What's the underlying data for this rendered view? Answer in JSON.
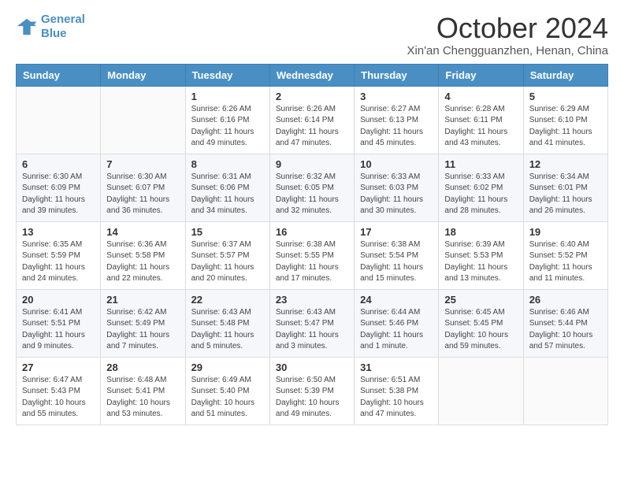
{
  "logo": {
    "line1": "General",
    "line2": "Blue"
  },
  "title": "October 2024",
  "subtitle": "Xin'an Chengguanzhen, Henan, China",
  "weekdays": [
    "Sunday",
    "Monday",
    "Tuesday",
    "Wednesday",
    "Thursday",
    "Friday",
    "Saturday"
  ],
  "weeks": [
    [
      {
        "day": "",
        "info": ""
      },
      {
        "day": "",
        "info": ""
      },
      {
        "day": "1",
        "info": "Sunrise: 6:26 AM\nSunset: 6:16 PM\nDaylight: 11 hours and 49 minutes."
      },
      {
        "day": "2",
        "info": "Sunrise: 6:26 AM\nSunset: 6:14 PM\nDaylight: 11 hours and 47 minutes."
      },
      {
        "day": "3",
        "info": "Sunrise: 6:27 AM\nSunset: 6:13 PM\nDaylight: 11 hours and 45 minutes."
      },
      {
        "day": "4",
        "info": "Sunrise: 6:28 AM\nSunset: 6:11 PM\nDaylight: 11 hours and 43 minutes."
      },
      {
        "day": "5",
        "info": "Sunrise: 6:29 AM\nSunset: 6:10 PM\nDaylight: 11 hours and 41 minutes."
      }
    ],
    [
      {
        "day": "6",
        "info": "Sunrise: 6:30 AM\nSunset: 6:09 PM\nDaylight: 11 hours and 39 minutes."
      },
      {
        "day": "7",
        "info": "Sunrise: 6:30 AM\nSunset: 6:07 PM\nDaylight: 11 hours and 36 minutes."
      },
      {
        "day": "8",
        "info": "Sunrise: 6:31 AM\nSunset: 6:06 PM\nDaylight: 11 hours and 34 minutes."
      },
      {
        "day": "9",
        "info": "Sunrise: 6:32 AM\nSunset: 6:05 PM\nDaylight: 11 hours and 32 minutes."
      },
      {
        "day": "10",
        "info": "Sunrise: 6:33 AM\nSunset: 6:03 PM\nDaylight: 11 hours and 30 minutes."
      },
      {
        "day": "11",
        "info": "Sunrise: 6:33 AM\nSunset: 6:02 PM\nDaylight: 11 hours and 28 minutes."
      },
      {
        "day": "12",
        "info": "Sunrise: 6:34 AM\nSunset: 6:01 PM\nDaylight: 11 hours and 26 minutes."
      }
    ],
    [
      {
        "day": "13",
        "info": "Sunrise: 6:35 AM\nSunset: 5:59 PM\nDaylight: 11 hours and 24 minutes."
      },
      {
        "day": "14",
        "info": "Sunrise: 6:36 AM\nSunset: 5:58 PM\nDaylight: 11 hours and 22 minutes."
      },
      {
        "day": "15",
        "info": "Sunrise: 6:37 AM\nSunset: 5:57 PM\nDaylight: 11 hours and 20 minutes."
      },
      {
        "day": "16",
        "info": "Sunrise: 6:38 AM\nSunset: 5:55 PM\nDaylight: 11 hours and 17 minutes."
      },
      {
        "day": "17",
        "info": "Sunrise: 6:38 AM\nSunset: 5:54 PM\nDaylight: 11 hours and 15 minutes."
      },
      {
        "day": "18",
        "info": "Sunrise: 6:39 AM\nSunset: 5:53 PM\nDaylight: 11 hours and 13 minutes."
      },
      {
        "day": "19",
        "info": "Sunrise: 6:40 AM\nSunset: 5:52 PM\nDaylight: 11 hours and 11 minutes."
      }
    ],
    [
      {
        "day": "20",
        "info": "Sunrise: 6:41 AM\nSunset: 5:51 PM\nDaylight: 11 hours and 9 minutes."
      },
      {
        "day": "21",
        "info": "Sunrise: 6:42 AM\nSunset: 5:49 PM\nDaylight: 11 hours and 7 minutes."
      },
      {
        "day": "22",
        "info": "Sunrise: 6:43 AM\nSunset: 5:48 PM\nDaylight: 11 hours and 5 minutes."
      },
      {
        "day": "23",
        "info": "Sunrise: 6:43 AM\nSunset: 5:47 PM\nDaylight: 11 hours and 3 minutes."
      },
      {
        "day": "24",
        "info": "Sunrise: 6:44 AM\nSunset: 5:46 PM\nDaylight: 11 hours and 1 minute."
      },
      {
        "day": "25",
        "info": "Sunrise: 6:45 AM\nSunset: 5:45 PM\nDaylight: 10 hours and 59 minutes."
      },
      {
        "day": "26",
        "info": "Sunrise: 6:46 AM\nSunset: 5:44 PM\nDaylight: 10 hours and 57 minutes."
      }
    ],
    [
      {
        "day": "27",
        "info": "Sunrise: 6:47 AM\nSunset: 5:43 PM\nDaylight: 10 hours and 55 minutes."
      },
      {
        "day": "28",
        "info": "Sunrise: 6:48 AM\nSunset: 5:41 PM\nDaylight: 10 hours and 53 minutes."
      },
      {
        "day": "29",
        "info": "Sunrise: 6:49 AM\nSunset: 5:40 PM\nDaylight: 10 hours and 51 minutes."
      },
      {
        "day": "30",
        "info": "Sunrise: 6:50 AM\nSunset: 5:39 PM\nDaylight: 10 hours and 49 minutes."
      },
      {
        "day": "31",
        "info": "Sunrise: 6:51 AM\nSunset: 5:38 PM\nDaylight: 10 hours and 47 minutes."
      },
      {
        "day": "",
        "info": ""
      },
      {
        "day": "",
        "info": ""
      }
    ]
  ]
}
